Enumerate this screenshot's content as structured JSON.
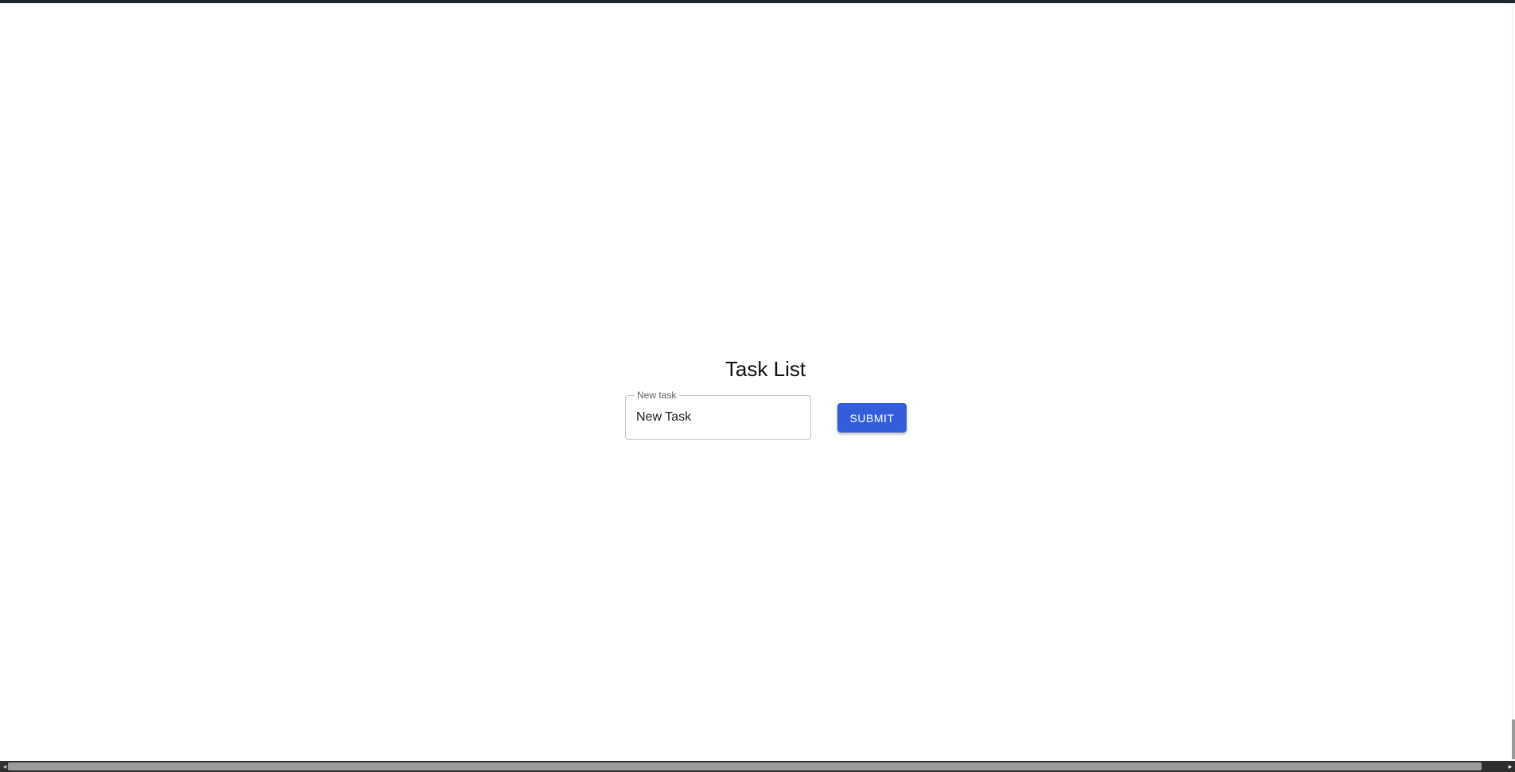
{
  "page": {
    "title": "Task List"
  },
  "task_form": {
    "label": "New task",
    "value": "New Task",
    "submit_label": "SUBMIT"
  },
  "scrollbar": {
    "left_arrow": "◂",
    "right_arrow": "▸"
  },
  "colors": {
    "accent": "#345ddb",
    "frame": "#1f2529"
  }
}
